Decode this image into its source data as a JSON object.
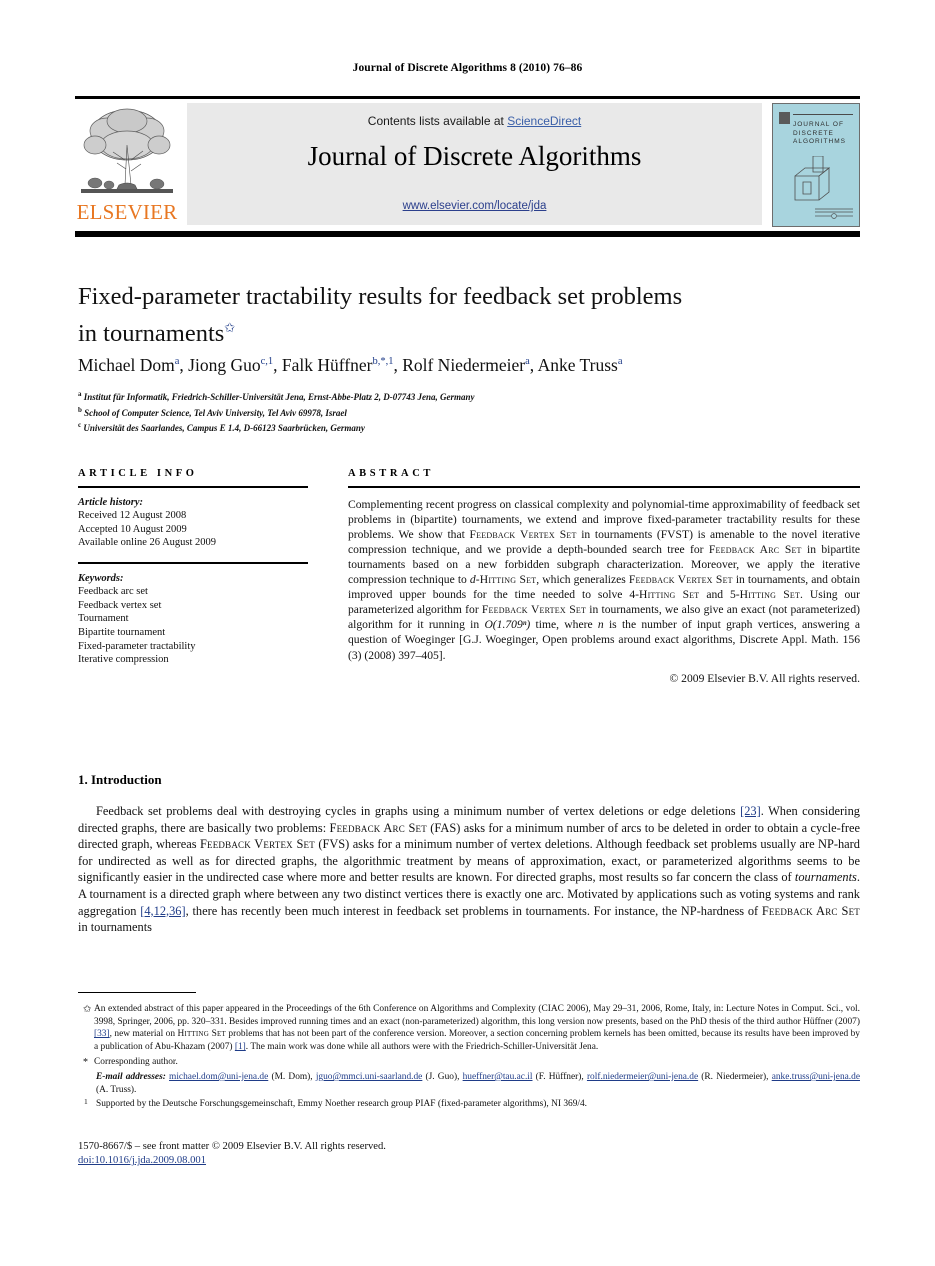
{
  "running_head": "Journal of Discrete Algorithms 8 (2010) 76–86",
  "masthead": {
    "contents_prefix": "Contents lists available at ",
    "sciencedirect": "ScienceDirect",
    "journal_title": "Journal of Discrete Algorithms",
    "url": "www.elsevier.com/locate/jda",
    "publisher_wordmark": "ELSEVIER",
    "cover_text_line1": "JOURNAL OF",
    "cover_text_line2": "DISCRETE",
    "cover_text_line3": "ALGORITHMS",
    "accent_orange": "#e87722",
    "box_gray": "#e9e9e9",
    "cover_blue": "#a8d4de",
    "link_blue": "#2b3f8c"
  },
  "title": {
    "line1": "Fixed-parameter tractability results for feedback set problems",
    "line2": "in tournaments",
    "footnote_marker": "✩"
  },
  "authors_line": "Michael Dom a, Jiong Guo c,1, Falk Hüffner b,*,1, Rolf Niedermeier a, Anke Truss a",
  "authors": [
    {
      "name": "Michael Dom",
      "marks": "a"
    },
    {
      "name": "Jiong Guo",
      "marks": "c,1"
    },
    {
      "name": "Falk Hüffner",
      "marks": "b,*,1"
    },
    {
      "name": "Rolf Niedermeier",
      "marks": "a"
    },
    {
      "name": "Anke Truss",
      "marks": "a"
    }
  ],
  "affiliations": [
    {
      "mark": "a",
      "text": "Institut für Informatik, Friedrich-Schiller-Universität Jena, Ernst-Abbe-Platz 2, D-07743 Jena, Germany"
    },
    {
      "mark": "b",
      "text": "School of Computer Science, Tel Aviv University, Tel Aviv 69978, Israel"
    },
    {
      "mark": "c",
      "text": "Universität des Saarlandes, Campus E 1.4, D-66123 Saarbrücken, Germany"
    }
  ],
  "article_info": {
    "heading": "ARTICLE INFO",
    "history_label": "Article history:",
    "history": [
      "Received 12 August 2008",
      "Accepted 10 August 2009",
      "Available online 26 August 2009"
    ],
    "keywords_label": "Keywords:",
    "keywords": [
      "Feedback arc set",
      "Feedback vertex set",
      "Tournament",
      "Bipartite tournament",
      "Fixed-parameter tractability",
      "Iterative compression"
    ]
  },
  "abstract": {
    "heading": "ABSTRACT",
    "p1_a": "Complementing recent progress on classical complexity and polynomial-time approximability of feedback set problems in (bipartite) tournaments, we extend and improve fixed-parameter tractability results for these problems. We show that ",
    "sc1": "Feedback Vertex Set",
    "p1_b": " in tournaments (FVST) is amenable to the novel iterative compression technique, and we provide a depth-bounded search tree for ",
    "sc2": "Feedback Arc Set",
    "p1_c": " in bipartite tournaments based on a new forbidden subgraph characterization. Moreover, we apply the iterative compression technique to ",
    "italic_d": "d",
    "sc3": "-Hitting Set",
    "p1_d": ", which generalizes ",
    "sc4": "Feedback Vertex Set",
    "p1_e": " in tournaments, and obtain improved upper bounds for the time needed to solve 4-",
    "sc5": "Hitting Set",
    "p1_f": " and 5-",
    "sc6": "Hitting Set",
    "p1_g": ". Using our parameterized algorithm for ",
    "sc7": "Feedback Vertex Set",
    "p1_h": " in tournaments, we also give an exact (not parameterized) algorithm for it running in ",
    "formula": "O(1.709ⁿ)",
    "p1_i": " time, where ",
    "italic_n": "n",
    "p1_j": " is the number of input graph vertices, answering a question of Woeginger [G.J. Woeginger, Open problems around exact algorithms, Discrete Appl. Math. 156 (3) (2008) 397–405].",
    "copyright": "© 2009 Elsevier B.V. All rights reserved."
  },
  "section": {
    "number_title": "1. Introduction"
  },
  "body": {
    "t1": "Feedback set problems deal with destroying cycles in graphs using a minimum number of vertex deletions or edge deletions ",
    "r1": "[23]",
    "t2": ". When considering directed graphs, there are basically two problems: ",
    "sc1": "Feedback Arc Set",
    "t3": " (FAS) asks for a minimum number of arcs to be deleted in order to obtain a cycle-free directed graph, whereas ",
    "sc2": "Feedback Vertex Set",
    "t4": " (FVS) asks for a minimum number of vertex deletions. Although feedback set problems usually are NP-hard for undirected as well as for directed graphs, the algorithmic treatment by means of approximation, exact, or parameterized algorithms seems to be significantly easier in the undirected case where more and better results are known. For directed graphs, most results so far concern the class of ",
    "it1": "tournaments",
    "t5": ". A tournament is a directed graph where between any two distinct vertices there is exactly one arc. Motivated by applications such as voting systems and rank aggregation ",
    "r2": "[4,12,36]",
    "t6": ", there has recently been much interest in feedback set problems in tournaments. For instance, the NP-hardness of ",
    "sc3": "Feedback Arc Set",
    "t7": " in tournaments"
  },
  "footnotes": {
    "star_marker": "✩",
    "star_a": "An extended abstract of this paper appeared in the Proceedings of the 6th Conference on Algorithms and Complexity (CIAC 2006), May 29–31, 2006, Rome, Italy, in: Lecture Notes in Comput. Sci., vol. 3998, Springer, 2006, pp. 320–331. Besides improved running times and an exact (non-parameterized) algorithm, this long version now presents, based on the PhD thesis of the third author Hüffner (2007) ",
    "star_ref1": "[33]",
    "star_b": ", new material on ",
    "star_sc": "Hitting Set",
    "star_c": " problems that has not been part of the conference version. Moreover, a section concerning problem kernels has been omitted, because its results have been improved by a publication of Abu-Khazam (2007) ",
    "star_ref2": "[1]",
    "star_d": ". The main work was done while all authors were with the Friedrich-Schiller-Universität Jena.",
    "corresponding_marker": "*",
    "corresponding": "Corresponding author.",
    "emails_label": "E-mail addresses:",
    "emails": [
      {
        "mail": "michael.dom@uni-jena.de",
        "who": " (M. Dom), "
      },
      {
        "mail": "jguo@mmci.uni-saarland.de",
        "who": " (J. Guo), "
      },
      {
        "mail": "hueffner@tau.ac.il",
        "who": " (F. Hüffner), "
      },
      {
        "mail": "rolf.niedermeier@uni-jena.de",
        "who": " (R. Niedermeier), "
      },
      {
        "mail": "anke.truss@uni-jena.de",
        "who": " (A. Truss)."
      }
    ],
    "one_marker": "1",
    "one_text": "Supported by the Deutsche Forschungsgemeinschaft, Emmy Noether research group PIAF (fixed-parameter algorithms), NI 369/4."
  },
  "imprint": {
    "line1": "1570-8667/$ – see front matter © 2009 Elsevier B.V. All rights reserved.",
    "doi": "doi:10.1016/j.jda.2009.08.001"
  }
}
